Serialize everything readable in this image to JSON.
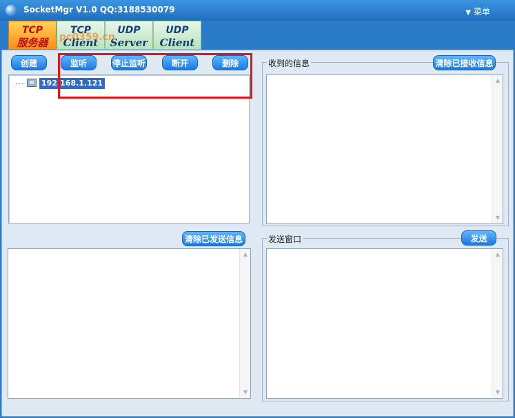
{
  "window": {
    "title": "SocketMgr V1.0  QQ:3188530079",
    "menu_label": "菜单",
    "icon": "globe-app-icon"
  },
  "tabs": [
    {
      "line1": "TCP",
      "line2": "服务器",
      "active": true
    },
    {
      "line1": "TCP",
      "line2": "Client",
      "active": false
    },
    {
      "line1": "UDP",
      "line2": "Server",
      "active": false
    },
    {
      "line1": "UDP",
      "line2": "Client",
      "active": false
    }
  ],
  "watermark": "pc0359.cn",
  "toolbar": {
    "create": "创建",
    "listen": "监听",
    "stop_listen": "停止监听",
    "disconnect": "断开",
    "delete": "删除"
  },
  "tree": {
    "items": [
      {
        "label": "192.168.1.121",
        "icon": "computer-icon",
        "selected": true
      }
    ]
  },
  "received": {
    "label": "收到的信息",
    "clear_button": "清除已接收信息",
    "content": ""
  },
  "sent_log": {
    "clear_button": "清除已发送信息",
    "content": ""
  },
  "send_window": {
    "label": "发送窗口",
    "send_button": "发送",
    "content": ""
  },
  "colors": {
    "accent": "#1a7be0",
    "highlight": "#e0161e",
    "selection": "#316ac5"
  }
}
